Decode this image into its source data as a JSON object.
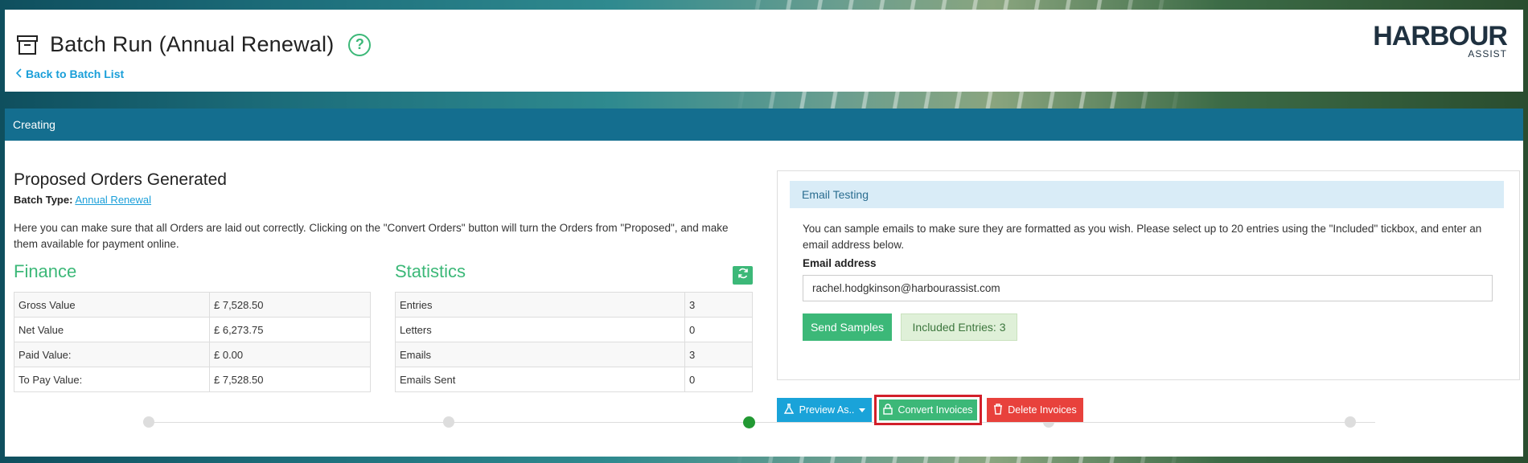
{
  "header": {
    "title": "Batch Run (Annual Renewal)",
    "back_link": "Back to Batch List",
    "logo_main": "HARBOUR",
    "logo_sub": "ASSIST"
  },
  "status_bar": {
    "label": "Creating"
  },
  "main": {
    "section_title": "Proposed Orders Generated",
    "batch_type_label": "Batch Type:",
    "batch_type_value": "Annual Renewal",
    "intro": "Here you can make sure that all Orders are laid out correctly. Clicking on the \"Convert Orders\" button will turn the Orders from \"Proposed\", and make them available for payment online."
  },
  "finance": {
    "title": "Finance",
    "rows": [
      {
        "label": "Gross Value",
        "value": "£ 7,528.50"
      },
      {
        "label": "Net Value",
        "value": "£ 6,273.75"
      },
      {
        "label": "Paid Value:",
        "value": "£ 0.00"
      },
      {
        "label": "To Pay Value:",
        "value": "£ 7,528.50"
      }
    ]
  },
  "statistics": {
    "title": "Statistics",
    "rows": [
      {
        "label": "Entries",
        "value": "3"
      },
      {
        "label": "Letters",
        "value": "0"
      },
      {
        "label": "Emails",
        "value": "3"
      },
      {
        "label": "Emails Sent",
        "value": "0"
      }
    ]
  },
  "email_testing": {
    "heading": "Email Testing",
    "description": "You can sample emails to make sure they are formatted as you wish. Please select up to 20 entries using the \"Included\" tickbox, and enter an email address below.",
    "email_label": "Email address",
    "email_value": "rachel.hodgkinson@harbourassist.com",
    "send_button": "Send Samples",
    "included_entries": "Included Entries: 3"
  },
  "actions": {
    "preview": "Preview As..",
    "convert": "Convert Invoices",
    "delete": "Delete Invoices"
  },
  "progress": {
    "steps": 5,
    "current_step": 3
  },
  "colors": {
    "accent_green": "#3cb878",
    "status_bar": "#146e8f",
    "link_blue": "#1a9fd9",
    "delete_red": "#e8413c",
    "highlight_red": "#d21f2a"
  }
}
